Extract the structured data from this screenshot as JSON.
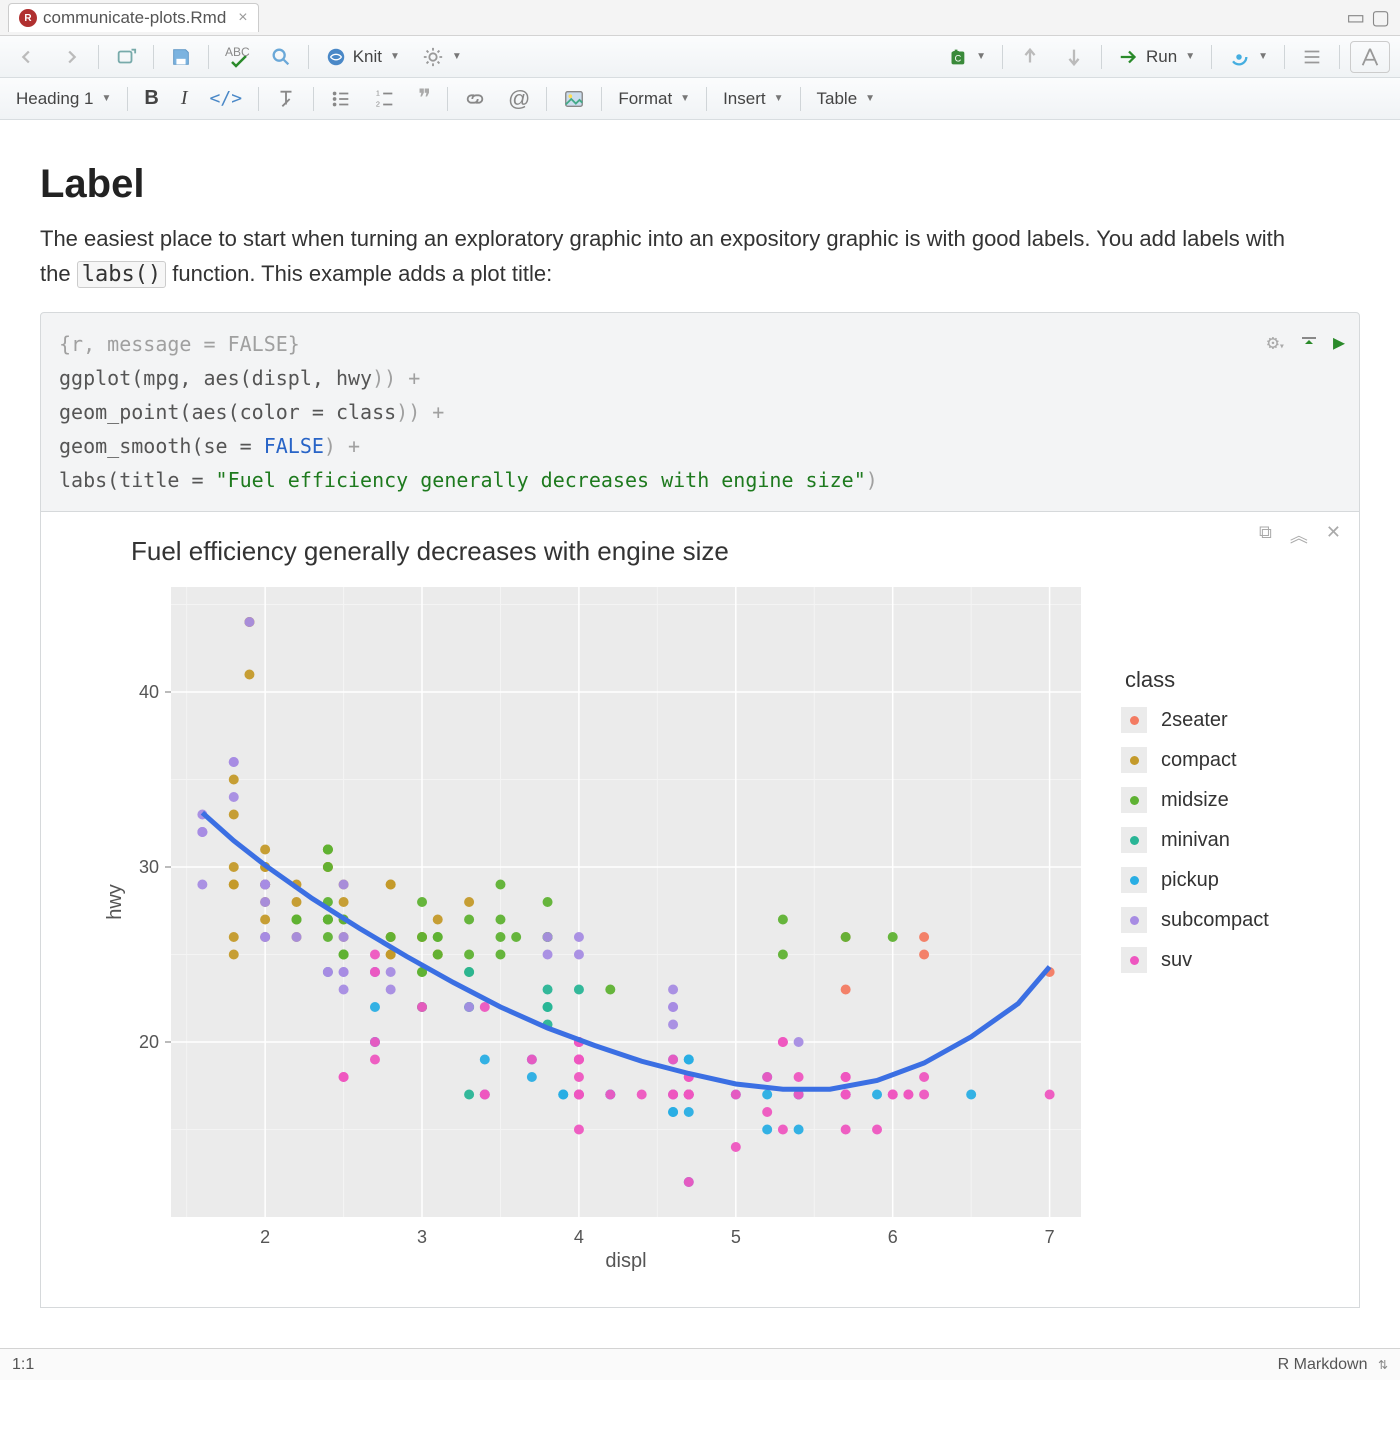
{
  "tab": {
    "filename": "communicate-plots.Rmd"
  },
  "toolbar": {
    "knit_label": "Knit",
    "run_label": "Run",
    "heading_label": "Heading 1",
    "format_label": "Format",
    "insert_label": "Insert",
    "table_label": "Table"
  },
  "doc": {
    "h1": "Label",
    "prose_before": "The easiest place to start when turning an exploratory graphic into an expository graphic is with good labels. You add labels with the ",
    "code_inline": "labs()",
    "prose_after": " function. This example adds a plot title:"
  },
  "chunk": {
    "header": "{r, message = FALSE}",
    "l1a": "ggplot(mpg, aes(displ, hwy",
    "l1b": ")) +",
    "l2a": "  geom_point(aes(color = class",
    "l2b": ")) +",
    "l3a": "  geom_smooth(se = ",
    "l3_false": "FALSE",
    "l3b": ") +",
    "l4a": "  labs(title = ",
    "l4_str": "\"Fuel efficiency generally decreases with engine size\"",
    "l4b": ")"
  },
  "status": {
    "pos": "1:1",
    "lang": "R Markdown"
  },
  "chart_data": {
    "type": "scatter",
    "title": "Fuel efficiency generally decreases with engine size",
    "xlabel": "displ",
    "ylabel": "hwy",
    "xlim": [
      1.4,
      7.2
    ],
    "ylim": [
      10,
      46
    ],
    "x_ticks": [
      2,
      3,
      4,
      5,
      6,
      7
    ],
    "y_ticks": [
      20,
      30,
      40
    ],
    "legend_title": "class",
    "colors": {
      "2seater": "#f37b62",
      "compact": "#c49a2a",
      "midsize": "#5fb233",
      "minivan": "#29b596",
      "pickup": "#29aee4",
      "subcompact": "#a78ce3",
      "suv": "#ee56c0"
    },
    "legend_order": [
      "2seater",
      "compact",
      "midsize",
      "minivan",
      "pickup",
      "subcompact",
      "suv"
    ],
    "series": [
      {
        "name": "2seater",
        "points": [
          [
            5.7,
            26
          ],
          [
            5.7,
            23
          ],
          [
            6.2,
            26
          ],
          [
            6.2,
            25
          ],
          [
            7.0,
            24
          ]
        ]
      },
      {
        "name": "compact",
        "points": [
          [
            1.8,
            29
          ],
          [
            1.8,
            29
          ],
          [
            2.0,
            31
          ],
          [
            2.0,
            30
          ],
          [
            2.8,
            26
          ],
          [
            2.8,
            26
          ],
          [
            3.1,
            27
          ],
          [
            1.8,
            26
          ],
          [
            1.8,
            25
          ],
          [
            2.0,
            28
          ],
          [
            2.0,
            27
          ],
          [
            2.8,
            25
          ],
          [
            2.8,
            25
          ],
          [
            3.1,
            25
          ],
          [
            3.1,
            25
          ],
          [
            2.4,
            30
          ],
          [
            2.4,
            30
          ],
          [
            2.5,
            26
          ],
          [
            2.5,
            27
          ],
          [
            2.2,
            27
          ],
          [
            2.2,
            29
          ],
          [
            2.4,
            31
          ],
          [
            2.4,
            31
          ],
          [
            3.0,
            26
          ],
          [
            2.2,
            26
          ],
          [
            2.2,
            28
          ],
          [
            2.4,
            27
          ],
          [
            2.4,
            30
          ],
          [
            3.0,
            26
          ],
          [
            3.3,
            28
          ],
          [
            1.8,
            30
          ],
          [
            1.8,
            33
          ],
          [
            1.8,
            35
          ],
          [
            2.0,
            30
          ],
          [
            2.0,
            29
          ],
          [
            1.9,
            44
          ],
          [
            1.9,
            41
          ],
          [
            2.0,
            29
          ],
          [
            2.0,
            26
          ],
          [
            2.5,
            28
          ],
          [
            2.5,
            29
          ],
          [
            2.8,
            29
          ],
          [
            2.8,
            29
          ],
          [
            1.9,
            44
          ],
          [
            2.0,
            29
          ],
          [
            2.0,
            29
          ]
        ]
      },
      {
        "name": "midsize",
        "points": [
          [
            2.8,
            26
          ],
          [
            3.1,
            25
          ],
          [
            4.2,
            23
          ],
          [
            5.3,
            25
          ],
          [
            5.3,
            27
          ],
          [
            5.7,
            26
          ],
          [
            6.0,
            26
          ],
          [
            2.4,
            27
          ],
          [
            2.4,
            30
          ],
          [
            3.1,
            26
          ],
          [
            3.5,
            29
          ],
          [
            3.6,
            26
          ],
          [
            2.4,
            26
          ],
          [
            2.4,
            27
          ],
          [
            2.4,
            28
          ],
          [
            2.4,
            27
          ],
          [
            2.5,
            25
          ],
          [
            2.5,
            25
          ],
          [
            3.3,
            27
          ],
          [
            2.5,
            27
          ],
          [
            2.5,
            25
          ],
          [
            3.5,
            25
          ],
          [
            3.0,
            26
          ],
          [
            3.3,
            25
          ],
          [
            3.3,
            24
          ],
          [
            3.0,
            24
          ],
          [
            3.0,
            22
          ],
          [
            3.5,
            26
          ],
          [
            3.1,
            26
          ],
          [
            2.2,
            27
          ],
          [
            2.2,
            27
          ],
          [
            2.4,
            31
          ],
          [
            2.4,
            31
          ],
          [
            3.0,
            28
          ],
          [
            3.0,
            24
          ],
          [
            3.5,
            27
          ],
          [
            2.4,
            27
          ],
          [
            3.8,
            26
          ],
          [
            3.8,
            28
          ],
          [
            3.8,
            26
          ],
          [
            3.8,
            26
          ]
        ]
      },
      {
        "name": "minivan",
        "points": [
          [
            2.4,
            24
          ],
          [
            3.0,
            22
          ],
          [
            3.3,
            22
          ],
          [
            3.3,
            22
          ],
          [
            3.3,
            17
          ],
          [
            3.8,
            21
          ],
          [
            3.8,
            22
          ],
          [
            4.0,
            23
          ],
          [
            3.3,
            24
          ],
          [
            3.8,
            23
          ],
          [
            3.8,
            22
          ]
        ]
      },
      {
        "name": "pickup",
        "points": [
          [
            3.7,
            19
          ],
          [
            3.7,
            18
          ],
          [
            3.9,
            17
          ],
          [
            3.9,
            17
          ],
          [
            4.7,
            19
          ],
          [
            4.7,
            19
          ],
          [
            4.7,
            12
          ],
          [
            5.2,
            17
          ],
          [
            5.2,
            15
          ],
          [
            5.9,
            17
          ],
          [
            4.7,
            17
          ],
          [
            4.7,
            17
          ],
          [
            4.7,
            16
          ],
          [
            5.2,
            18
          ],
          [
            5.7,
            17
          ],
          [
            6.5,
            17
          ],
          [
            2.7,
            20
          ],
          [
            2.7,
            20
          ],
          [
            2.7,
            22
          ],
          [
            3.4,
            17
          ],
          [
            3.4,
            19
          ],
          [
            4.0,
            20
          ],
          [
            4.0,
            17
          ],
          [
            4.6,
            19
          ],
          [
            5.0,
            17
          ],
          [
            4.2,
            17
          ],
          [
            4.2,
            17
          ],
          [
            4.6,
            16
          ],
          [
            4.6,
            16
          ],
          [
            4.6,
            17
          ],
          [
            5.4,
            15
          ],
          [
            5.4,
            17
          ],
          [
            5.4,
            17
          ]
        ]
      },
      {
        "name": "subcompact",
        "points": [
          [
            3.8,
            26
          ],
          [
            3.8,
            25
          ],
          [
            4.0,
            26
          ],
          [
            4.0,
            25
          ],
          [
            4.6,
            21
          ],
          [
            4.6,
            22
          ],
          [
            4.6,
            23
          ],
          [
            4.6,
            22
          ],
          [
            5.4,
            20
          ],
          [
            1.6,
            33
          ],
          [
            1.6,
            32
          ],
          [
            1.6,
            32
          ],
          [
            1.6,
            29
          ],
          [
            1.6,
            32
          ],
          [
            1.8,
            34
          ],
          [
            1.8,
            36
          ],
          [
            1.8,
            36
          ],
          [
            2.0,
            29
          ],
          [
            2.4,
            24
          ],
          [
            2.4,
            24
          ],
          [
            2.5,
            24
          ],
          [
            2.5,
            24
          ],
          [
            3.3,
            22
          ],
          [
            2.0,
            26
          ],
          [
            2.0,
            28
          ],
          [
            2.0,
            26
          ],
          [
            2.0,
            29
          ],
          [
            2.7,
            24
          ],
          [
            2.7,
            24
          ],
          [
            2.7,
            24
          ],
          [
            2.2,
            26
          ],
          [
            2.5,
            23
          ],
          [
            2.5,
            26
          ],
          [
            1.9,
            44
          ],
          [
            2.0,
            29
          ],
          [
            2.5,
            29
          ],
          [
            2.8,
            24
          ],
          [
            2.8,
            23
          ]
        ]
      },
      {
        "name": "suv",
        "points": [
          [
            5.3,
            20
          ],
          [
            5.3,
            15
          ],
          [
            5.3,
            20
          ],
          [
            5.7,
            17
          ],
          [
            6.0,
            17
          ],
          [
            5.7,
            18
          ],
          [
            5.7,
            17
          ],
          [
            6.2,
            18
          ],
          [
            6.2,
            17
          ],
          [
            7.0,
            17
          ],
          [
            6.1,
            17
          ],
          [
            4.0,
            17
          ],
          [
            4.0,
            17
          ],
          [
            4.7,
            18
          ],
          [
            4.7,
            17
          ],
          [
            4.7,
            17
          ],
          [
            4.7,
            17
          ],
          [
            4.7,
            18
          ],
          [
            5.2,
            16
          ],
          [
            5.2,
            18
          ],
          [
            5.7,
            18
          ],
          [
            5.9,
            15
          ],
          [
            4.0,
            19
          ],
          [
            4.0,
            19
          ],
          [
            4.0,
            19
          ],
          [
            4.0,
            19
          ],
          [
            4.6,
            19
          ],
          [
            5.0,
            17
          ],
          [
            3.0,
            22
          ],
          [
            3.7,
            19
          ],
          [
            4.0,
            20
          ],
          [
            4.7,
            17
          ],
          [
            4.7,
            12
          ],
          [
            4.7,
            17
          ],
          [
            5.7,
            18
          ],
          [
            6.1,
            17
          ],
          [
            4.0,
            17
          ],
          [
            4.2,
            17
          ],
          [
            4.4,
            17
          ],
          [
            4.6,
            17
          ],
          [
            5.4,
            17
          ],
          [
            5.4,
            18
          ],
          [
            4.0,
            15
          ],
          [
            4.0,
            18
          ],
          [
            4.6,
            17
          ],
          [
            5.0,
            14
          ],
          [
            2.5,
            18
          ],
          [
            2.5,
            18
          ],
          [
            2.7,
            20
          ],
          [
            2.7,
            19
          ],
          [
            3.4,
            17
          ],
          [
            3.4,
            17
          ],
          [
            4.0,
            20
          ],
          [
            4.7,
            17
          ],
          [
            5.7,
            15
          ],
          [
            2.7,
            25
          ],
          [
            2.7,
            24
          ],
          [
            3.4,
            22
          ],
          [
            4.0,
            20
          ],
          [
            4.7,
            17
          ],
          [
            5.7,
            17
          ],
          [
            6.0,
            17
          ]
        ]
      }
    ],
    "smooth_line": [
      [
        1.6,
        33.1
      ],
      [
        1.8,
        31.5
      ],
      [
        2.0,
        30.1
      ],
      [
        2.3,
        28.2
      ],
      [
        2.6,
        26.5
      ],
      [
        2.9,
        24.9
      ],
      [
        3.2,
        23.4
      ],
      [
        3.5,
        22.0
      ],
      [
        3.8,
        20.8
      ],
      [
        4.1,
        19.8
      ],
      [
        4.4,
        18.9
      ],
      [
        4.7,
        18.2
      ],
      [
        5.0,
        17.6
      ],
      [
        5.3,
        17.3
      ],
      [
        5.6,
        17.3
      ],
      [
        5.9,
        17.8
      ],
      [
        6.2,
        18.8
      ],
      [
        6.5,
        20.3
      ],
      [
        6.8,
        22.2
      ],
      [
        7.0,
        24.3
      ]
    ]
  }
}
